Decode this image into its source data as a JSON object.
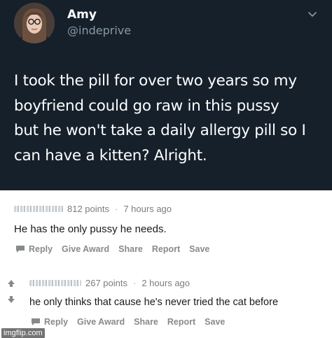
{
  "tweet": {
    "name": "Amy",
    "handle": "@indeprive",
    "text_lines": [
      "I took the pill for over two years so my",
      "boyfriend could go raw in this pussy",
      "but he won't take a daily allergy pill so I",
      "can have a kitten? Alright."
    ],
    "menu_icon": "chevron-down-icon",
    "colors": {
      "background": "#15202b",
      "text": "#ffffff",
      "handle": "#8899a6"
    }
  },
  "comments": [
    {
      "points": "812 points",
      "time": "7 hours ago",
      "body": "He has the only pussy he needs.",
      "actions": [
        "Reply",
        "Give Award",
        "Share",
        "Report",
        "Save"
      ]
    },
    {
      "points": "267 points",
      "time": "2 hours ago",
      "body": "he only thinks that cause he's never tried the cat before",
      "actions": [
        "Reply",
        "Give Award",
        "Share",
        "Report",
        "Save"
      ]
    }
  ],
  "watermark": "imgflip.com"
}
